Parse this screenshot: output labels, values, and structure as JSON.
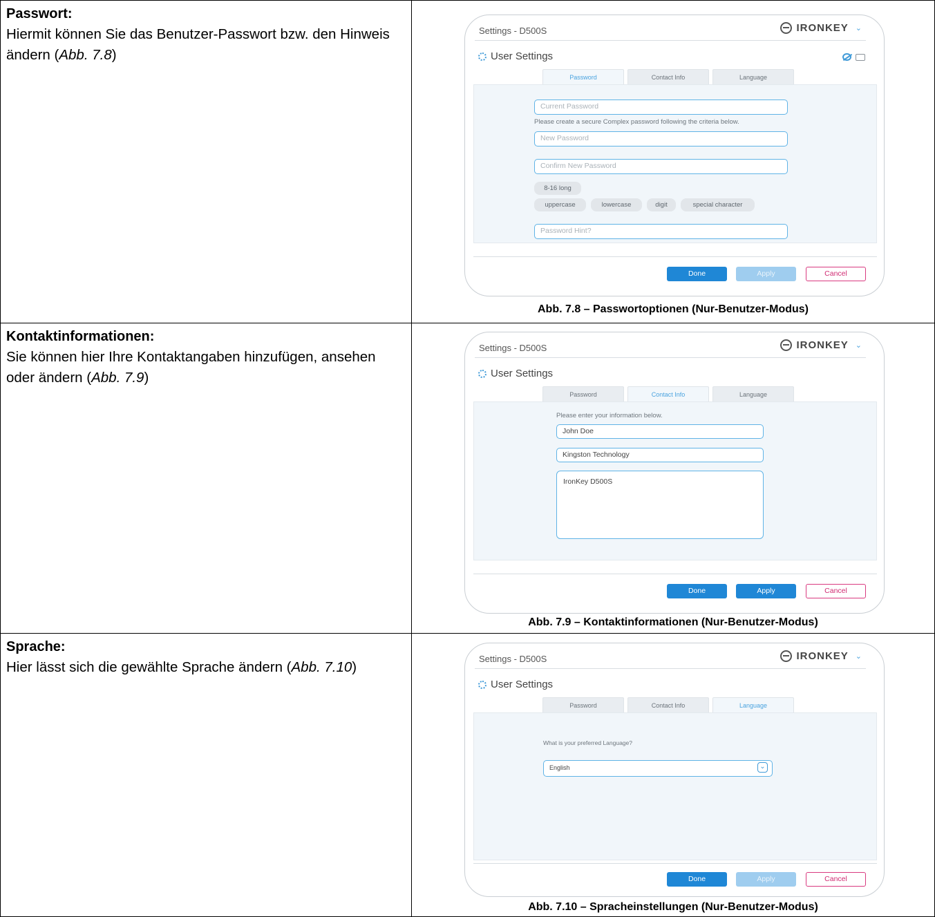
{
  "sections": [
    {
      "title": "Passwort:",
      "body_pre": "Hiermit können Sie das Benutzer-Passwort bzw. den Hinweis ändern (",
      "body_ref": "Abb. 7.8",
      "body_post": ")",
      "caption": "Abb. 7.8 – Passwortoptionen (Nur-Benutzer-Modus)"
    },
    {
      "title": "Kontaktinformationen:",
      "body_pre": "Sie können hier Ihre Kontaktangaben hinzufügen, ansehen oder ändern (",
      "body_ref": "Abb. 7.9",
      "body_post": ")",
      "caption": "Abb. 7.9 – Kontaktinformationen (Nur-Benutzer-Modus)"
    },
    {
      "title": "Sprache:",
      "body_pre": "Hier lässt sich die gewählte Sprache ändern (",
      "body_ref": "Abb. 7.10",
      "body_post": ")",
      "caption": "Abb. 7.10 – Spracheinstellungen (Nur-Benutzer-Modus)"
    }
  ],
  "window": {
    "title": "Settings - D500S",
    "brand": "IRONKEY",
    "brand_tm": "™",
    "heading": "User Settings",
    "tabs": [
      "Password",
      "Contact Info",
      "Language"
    ],
    "buttons": {
      "done": "Done",
      "apply": "Apply",
      "cancel": "Cancel"
    }
  },
  "password_tab": {
    "current_placeholder": "Current Password",
    "instruction": "Please create a secure Complex password following the criteria below.",
    "new_placeholder": "New Password",
    "confirm_placeholder": "Confirm New Password",
    "criteria": [
      "8-16 long",
      "uppercase",
      "lowercase",
      "digit",
      "special character"
    ],
    "hint_placeholder": "Password Hint?",
    "apply_enabled": false
  },
  "contact_tab": {
    "instruction": "Please enter your information below.",
    "name": "John Doe",
    "company": "Kingston Technology",
    "details": "IronKey D500S",
    "apply_enabled": true
  },
  "language_tab": {
    "question": "What is your preferred Language?",
    "selected": "English",
    "apply_enabled": false
  },
  "colors": {
    "accent": "#1f87d6",
    "field_border": "#5fb3e6",
    "cancel": "#d02a72"
  }
}
